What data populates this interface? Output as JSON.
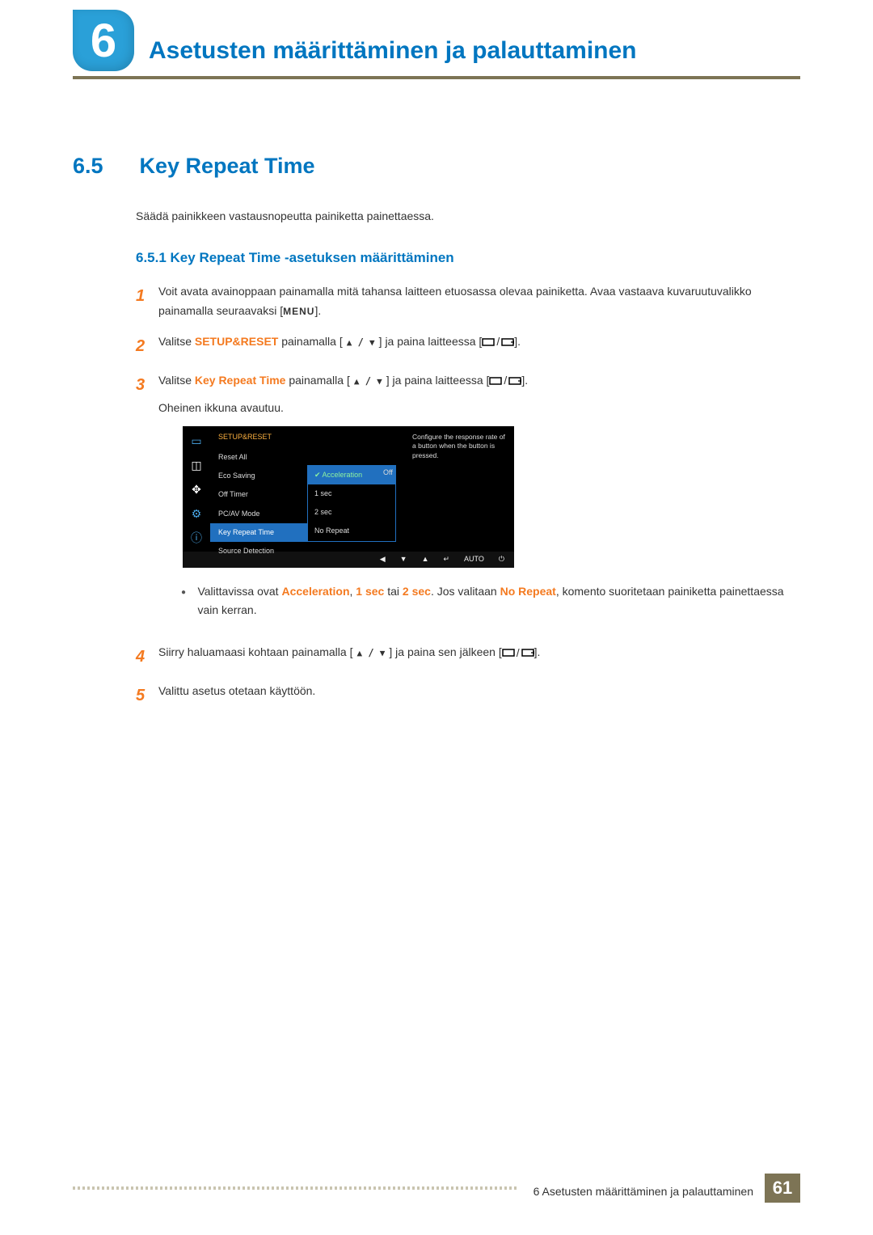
{
  "chapter": {
    "number": "6",
    "title": "Asetusten määrittäminen ja palauttaminen"
  },
  "section": {
    "number": "6.5",
    "title": "Key Repeat Time"
  },
  "intro": "Säädä painikkeen vastausnopeutta painiketta painettaessa.",
  "subsection": "6.5.1   Key Repeat Time -asetuksen määrittäminen",
  "steps": {
    "s1": {
      "num": "1",
      "a": "Voit avata avainoppaan painamalla mitä tahansa laitteen etuosassa olevaa painiketta. Avaa vastaava kuvaruutuvalikko painamalla seuraavaksi [",
      "menu": "MENU",
      "b": "]."
    },
    "s2": {
      "num": "2",
      "a": "Valitse ",
      "hl": "SETUP&RESET",
      "b": " painamalla [",
      "c": "] ja paina laitteessa [",
      "d": "]."
    },
    "s3": {
      "num": "3",
      "a": "Valitse ",
      "hl": "Key Repeat Time",
      "b": " painamalla [",
      "c": "] ja paina laitteessa [",
      "d": "].",
      "extra": "Oheinen ikkuna avautuu."
    },
    "bullet": {
      "a": "Valittavissa ovat ",
      "o1": "Acceleration",
      "comma": ", ",
      "o2": "1 sec",
      "or": " tai ",
      "o3": "2 sec",
      "mid": ". Jos valitaan ",
      "o4": "No Repeat",
      "end": ", komento suoritetaan painiketta painettaessa vain kerran."
    },
    "s4": {
      "num": "4",
      "a": "Siirry haluamaasi kohtaan painamalla [",
      "b": "] ja paina sen jälkeen [",
      "c": "]."
    },
    "s5": {
      "num": "5",
      "a": "Valittu asetus otetaan käyttöön."
    }
  },
  "osd": {
    "header": "SETUP&RESET",
    "items": [
      "Reset All",
      "Eco Saving",
      "Off Timer",
      "PC/AV Mode",
      "Key Repeat Time",
      "Source Detection"
    ],
    "value_off": "Off",
    "dropdown": [
      "Acceleration",
      "1 sec",
      "2 sec",
      "No Repeat"
    ],
    "help": "Configure the response rate of a button when the button is pressed.",
    "auto": "AUTO"
  },
  "footer": {
    "text": "6 Asetusten määrittäminen ja palauttaminen",
    "page": "61"
  }
}
